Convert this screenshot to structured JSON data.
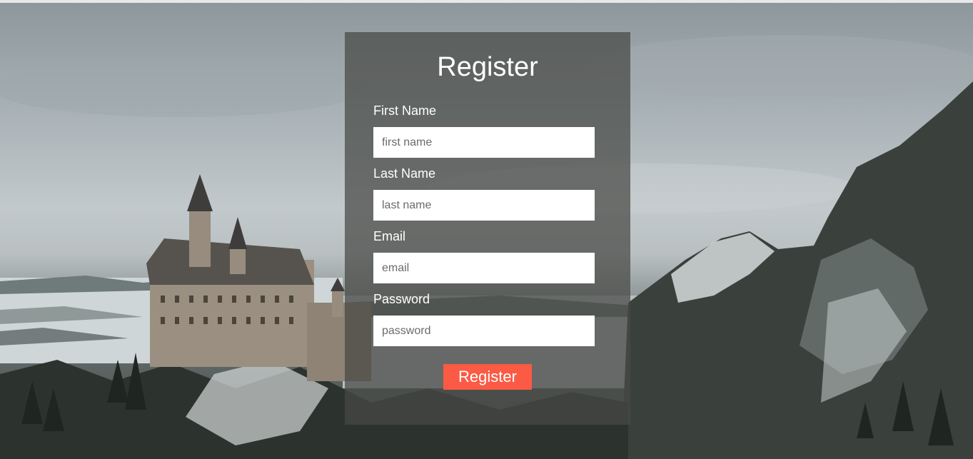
{
  "form": {
    "title": "Register",
    "fields": [
      {
        "label": "First Name",
        "placeholder": "first name",
        "type": "text"
      },
      {
        "label": "Last Name",
        "placeholder": "last name",
        "type": "text"
      },
      {
        "label": "Email",
        "placeholder": "email",
        "type": "email"
      },
      {
        "label": "Password",
        "placeholder": "password",
        "type": "password"
      }
    ],
    "submit_label": "Register"
  },
  "colors": {
    "panel_overlay": "#464844",
    "submit_button": "#fb5a45",
    "text": "#ffffff"
  },
  "background": {
    "description_icon": "castle-landscape-image"
  }
}
